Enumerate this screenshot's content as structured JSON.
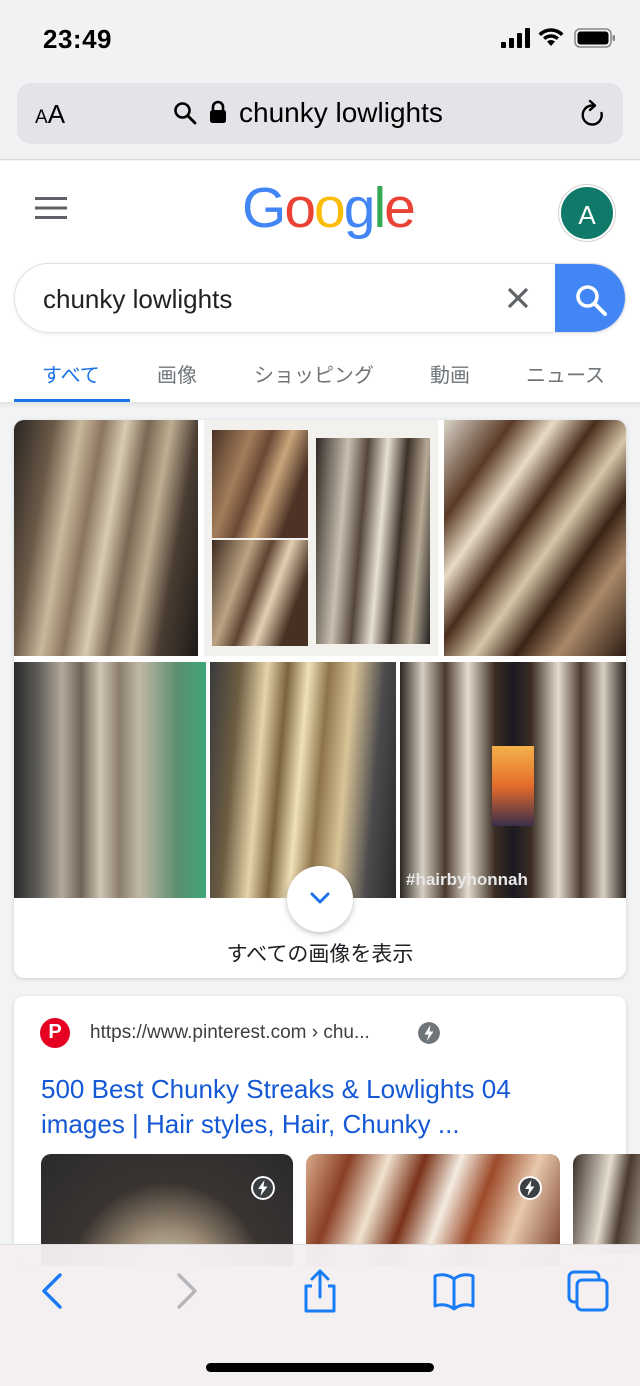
{
  "status": {
    "time": "23:49"
  },
  "browser": {
    "text_size_label": "AA",
    "url": "chunky lowlights"
  },
  "google": {
    "logo_letters": [
      {
        "ch": "G",
        "color": "#4285F4"
      },
      {
        "ch": "o",
        "color": "#EA4335"
      },
      {
        "ch": "o",
        "color": "#FBBC05"
      },
      {
        "ch": "g",
        "color": "#4285F4"
      },
      {
        "ch": "l",
        "color": "#34A853"
      },
      {
        "ch": "e",
        "color": "#EA4335"
      }
    ],
    "avatar_letter": "A",
    "query": "chunky lowlights",
    "tabs": [
      "すべて",
      "画像",
      "ショッピング",
      "動画",
      "ニュース"
    ],
    "active_tab": "すべて"
  },
  "images": {
    "show_all_label": "すべての画像を表示",
    "watermark": "#hairbyhonnah"
  },
  "result": {
    "site": "https://www.pinterest.com › chu...",
    "title": "500 Best Chunky Streaks & Lowlights 04 images | Hair styles, Hair, Chunky ..."
  },
  "colors": {
    "accent": "#1a73e8",
    "search_button": "#4285f4",
    "link": "#1558d6",
    "pinterest": "#e60023",
    "toolbar_icon": "#1a7cf5"
  }
}
